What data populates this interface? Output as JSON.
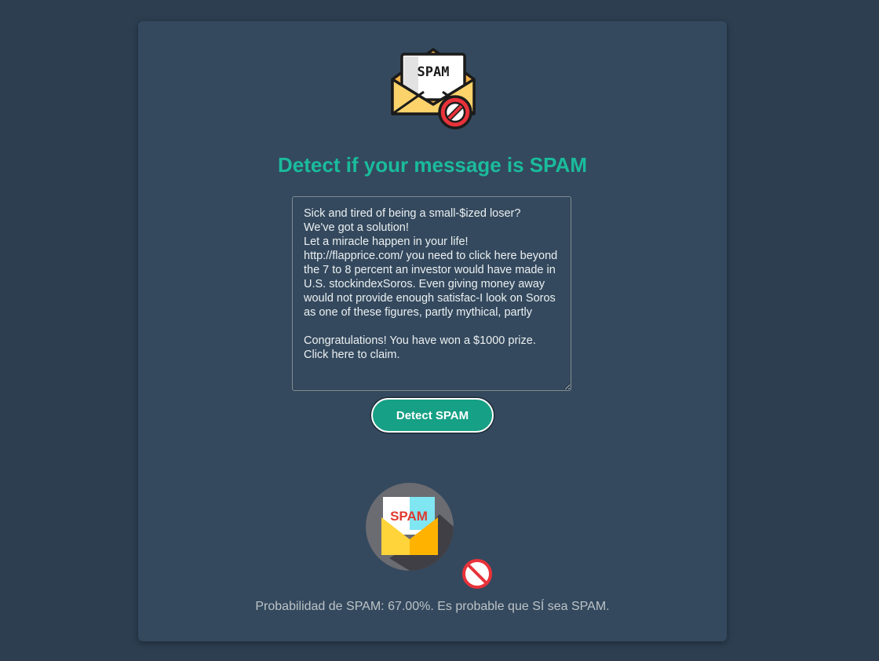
{
  "header": {
    "icon": "spam-envelope-icon",
    "envelope_letter_text": "SPAM",
    "title": "Detect if your message is SPAM"
  },
  "form": {
    "message_value": "Sick and tired of being a small-$ized loser?\nWe've got a solution!\nLet a miracle happen in your life!\nhttp://flapprice.com/ you need to click here beyond the 7 to 8 percent an investor would have made in U.S. stockindexSoros. Even giving money away would not provide enough satisfac-I look on Soros as one of these figures, partly mythical, partly\n\nCongratulations! You have won a $1000 prize. Click here to claim.",
    "detect_button_label": "Detect SPAM"
  },
  "result": {
    "image_icon": "spam-result-envelope-icon",
    "image_letter_text": "SPAM",
    "badge_icon": "prohibited-icon",
    "text": "Probabilidad de SPAM: 67.00%. Es probable que SÍ sea SPAM."
  },
  "colors": {
    "page_background": "#2c3e50",
    "card_background": "#34495e",
    "accent": "#1abc9c",
    "button": "#16a085",
    "danger": "#e74c3c"
  }
}
